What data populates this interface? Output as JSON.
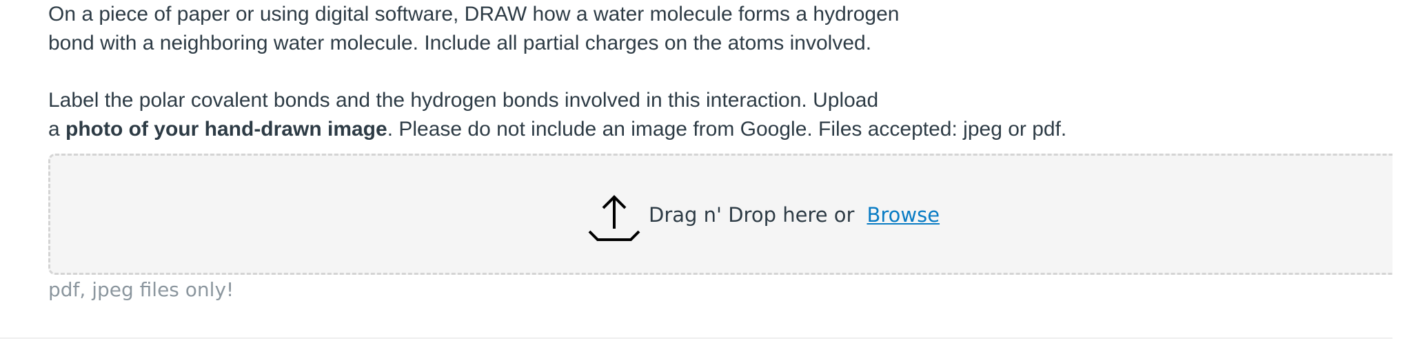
{
  "question": {
    "paragraph1": {
      "line1": "On a piece of paper or using digital software, DRAW how a water molecule forms a hydrogen",
      "line2": "bond with a neighboring water molecule. Include all partial charges on the atoms involved."
    },
    "paragraph2": {
      "line1": "Label the polar covalent bonds and the hydrogen bonds involved in this interaction. Upload",
      "line2_prefix": "a ",
      "line2_bold": "photo of your hand-drawn image",
      "line2_suffix": ". Please do not include an image from Google. Files accepted: jpeg or pdf."
    }
  },
  "upload": {
    "icon": "upload-icon",
    "prompt": "Drag n' Drop here or",
    "browse_label": "Browse",
    "hint": "pdf, jpeg files only!"
  },
  "colors": {
    "text": "#2d3b45",
    "link": "#0a7cc4",
    "hint": "#8b969e",
    "dropzone_bg": "#f5f5f5",
    "dropzone_border": "#d4d4d4"
  }
}
